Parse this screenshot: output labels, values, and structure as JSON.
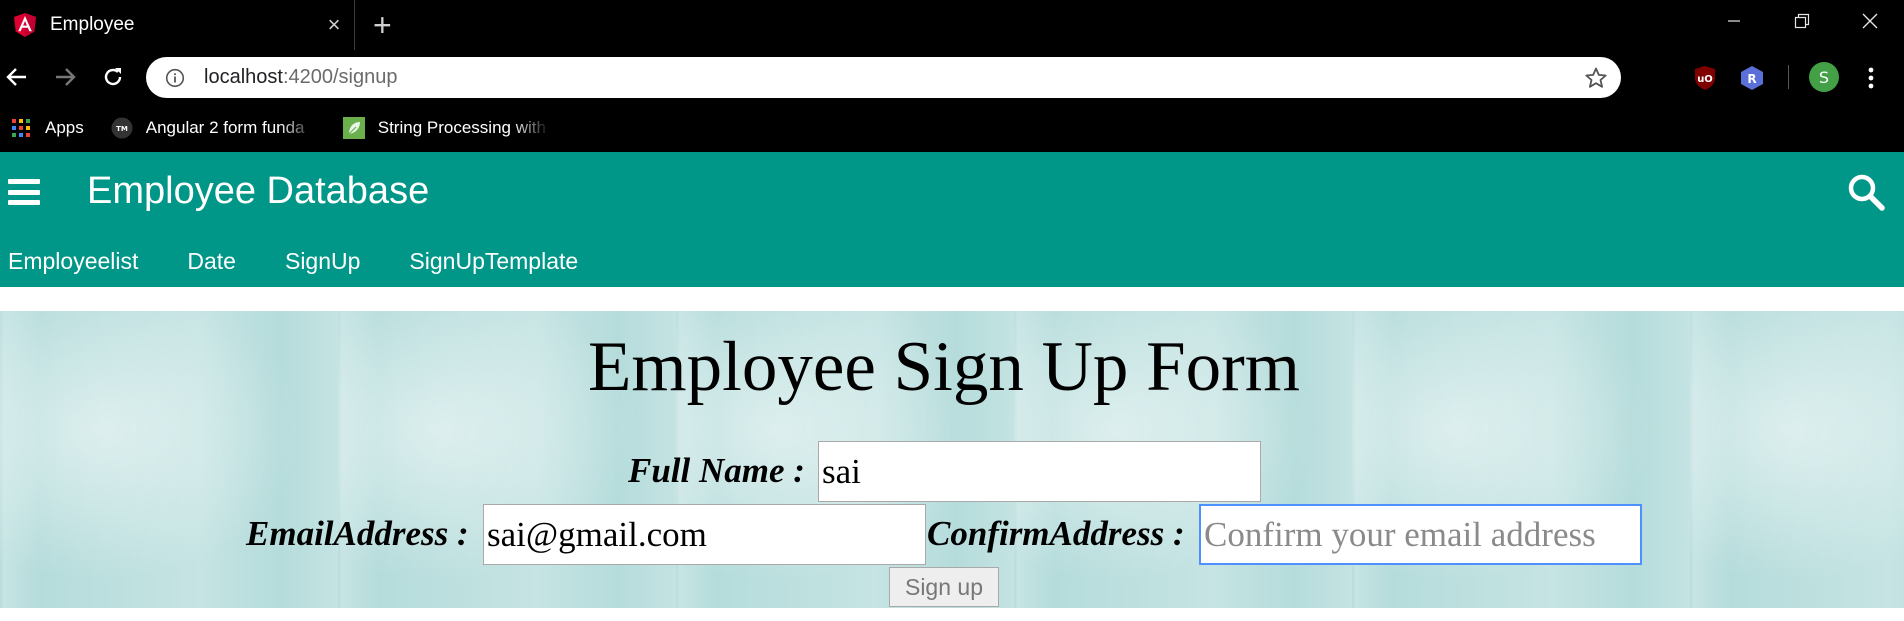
{
  "browser": {
    "tab_title": "Employee",
    "tab_close": "×",
    "new_tab": "+",
    "url_host": "localhost",
    "url_rest": ":4200/signup",
    "bookmarks": [
      {
        "label": "Apps",
        "icon": "apps-grid-icon"
      },
      {
        "label": "Angular 2 form funda",
        "icon": "tm-icon"
      },
      {
        "label": "String Processing with",
        "icon": "leaf-icon"
      }
    ],
    "profile_initial": "S",
    "ext_r_initial": "R"
  },
  "app": {
    "title": "Employee Database",
    "nav": [
      "Employeelist",
      "Date",
      "SignUp",
      "SignUpTemplate"
    ]
  },
  "form": {
    "title": "Employee Sign Up Form",
    "full_name_label": "Full Name :",
    "full_name_value": "sai",
    "email_label": "EmailAddress :",
    "email_value": "sai@gmail.com",
    "confirm_label": "ConfirmAddress :",
    "confirm_placeholder": "Confirm your email address",
    "submit_label": "Sign up"
  },
  "colors": {
    "header": "#009688",
    "form_bg": "#b5dcdb",
    "focus_border": "#4d90fe"
  }
}
